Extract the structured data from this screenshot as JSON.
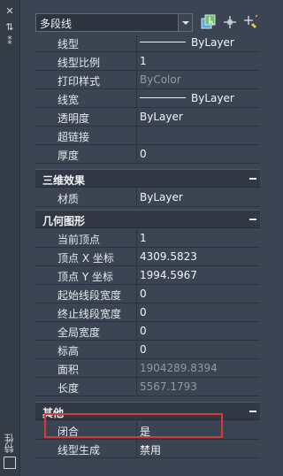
{
  "toolbar": {
    "object_type": "多段线",
    "icons": [
      "select-objects-icon",
      "pickadd-icon",
      "quick-select-icon"
    ]
  },
  "side": {
    "vertical_label": "特性"
  },
  "general": {
    "rows": [
      {
        "label": "线型",
        "value": "ByLayer",
        "has_line": true
      },
      {
        "label": "线型比例",
        "value": "1"
      },
      {
        "label": "打印样式",
        "value": "ByColor",
        "dim": true
      },
      {
        "label": "线宽",
        "value": "ByLayer",
        "has_line": true
      },
      {
        "label": "透明度",
        "value": "ByLayer"
      },
      {
        "label": "超链接",
        "value": ""
      },
      {
        "label": "厚度",
        "value": "0"
      }
    ]
  },
  "sections": {
    "effects": {
      "title": "三维效果",
      "rows": [
        {
          "label": "材质",
          "value": "ByLayer"
        }
      ]
    },
    "geometry": {
      "title": "几何图形",
      "rows": [
        {
          "label": "当前顶点",
          "value": "1"
        },
        {
          "label": "顶点 X 坐标",
          "value": "4309.5823"
        },
        {
          "label": "顶点 Y 坐标",
          "value": "1994.5967"
        },
        {
          "label": "起始线段宽度",
          "value": "0"
        },
        {
          "label": "终止线段宽度",
          "value": "0"
        },
        {
          "label": "全局宽度",
          "value": "0"
        },
        {
          "label": "标高",
          "value": "0"
        },
        {
          "label": "面积",
          "value": "1904289.8394",
          "dim": true
        },
        {
          "label": "长度",
          "value": "5567.1793",
          "dim": true
        }
      ]
    },
    "misc": {
      "title": "其他",
      "rows": [
        {
          "label": "闭合",
          "value": "是"
        },
        {
          "label": "线型生成",
          "value": "禁用"
        }
      ]
    }
  }
}
